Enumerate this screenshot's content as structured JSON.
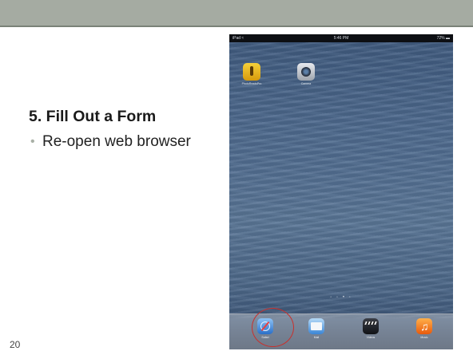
{
  "slide": {
    "title": "5. Fill Out a Form",
    "bullets": [
      "Re-open web browser"
    ],
    "number": "20"
  },
  "ipad": {
    "status_bar": {
      "carrier": "iPad ≈",
      "time": "5:46 PM",
      "battery": "72% ▬"
    },
    "home_apps": [
      {
        "label": "PhotoReadsPro",
        "icon": "photoreadpro-icon"
      },
      {
        "label": "Camera",
        "icon": "camera-icon"
      }
    ],
    "page_dots": "◦ ◦ • ◦",
    "dock_apps": [
      {
        "label": "Safari",
        "icon": "safari-icon",
        "highlighted": true
      },
      {
        "label": "Mail",
        "icon": "mail-icon"
      },
      {
        "label": "Videos",
        "icon": "videos-icon"
      },
      {
        "label": "Music",
        "icon": "music-icon"
      }
    ]
  },
  "colors": {
    "header_bar": "#a5aba2",
    "highlight_circle": "#c9302c"
  }
}
